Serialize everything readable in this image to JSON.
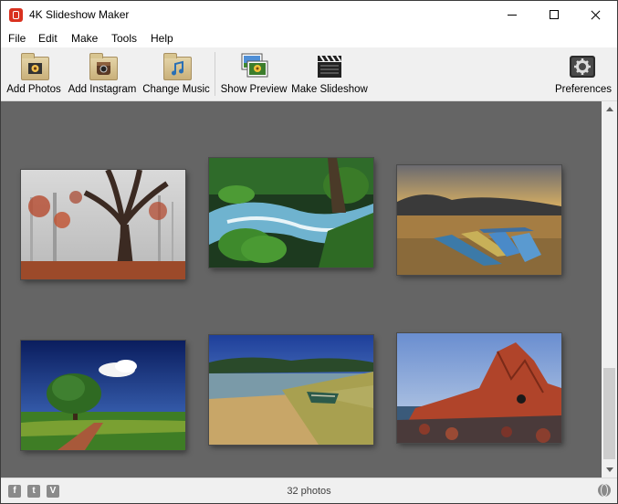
{
  "window": {
    "title": "4K Slideshow Maker",
    "controls": {
      "minimize": "minimize",
      "maximize": "maximize",
      "close": "close"
    }
  },
  "menu": {
    "items": [
      "File",
      "Edit",
      "Make",
      "Tools",
      "Help"
    ]
  },
  "toolbar": {
    "add_photos": "Add Photos",
    "add_instagram": "Add Instagram",
    "change_music": "Change Music",
    "show_preview": "Show Preview",
    "make_slideshow": "Make Slideshow",
    "preferences": "Preferences"
  },
  "gallery": {
    "photos": [
      {
        "subject": "foggy autumn forest with red leaves"
      },
      {
        "subject": "mountain stream with mossy rocks"
      },
      {
        "subject": "boats on a lake at sunset"
      },
      {
        "subject": "lone tree under blue sky"
      },
      {
        "subject": "rowboat on clear lake shore"
      },
      {
        "subject": "red rock formation by the sea"
      }
    ]
  },
  "status": {
    "photo_count": "32 photos",
    "social": {
      "facebook": "f",
      "twitter": "t",
      "vimeo": "V"
    }
  },
  "colors": {
    "content_background": "#656565",
    "toolbar_background": "#f0f0f0",
    "app_icon": "#d9311f"
  }
}
